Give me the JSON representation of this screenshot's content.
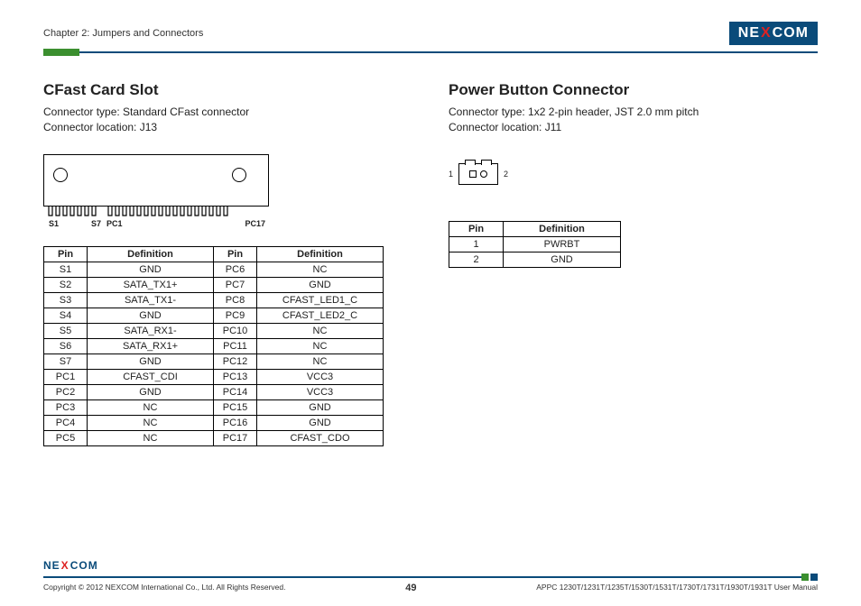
{
  "header": {
    "chapter": "Chapter 2: Jumpers and Connectors"
  },
  "left": {
    "title": "CFast Card Slot",
    "connector_type": "Connector type: Standard CFast connector",
    "connector_location": "Connector location: J13",
    "diagram_labels": {
      "s1": "S1",
      "s7": "S7",
      "pc1": "PC1",
      "pc17": "PC17"
    },
    "table": {
      "headers": {
        "pin": "Pin",
        "def": "Definition"
      },
      "rows": [
        {
          "p1": "S1",
          "d1": "GND",
          "p2": "PC6",
          "d2": "NC"
        },
        {
          "p1": "S2",
          "d1": "SATA_TX1+",
          "p2": "PC7",
          "d2": "GND"
        },
        {
          "p1": "S3",
          "d1": "SATA_TX1-",
          "p2": "PC8",
          "d2": "CFAST_LED1_C"
        },
        {
          "p1": "S4",
          "d1": "GND",
          "p2": "PC9",
          "d2": "CFAST_LED2_C"
        },
        {
          "p1": "S5",
          "d1": "SATA_RX1-",
          "p2": "PC10",
          "d2": "NC"
        },
        {
          "p1": "S6",
          "d1": "SATA_RX1+",
          "p2": "PC11",
          "d2": "NC"
        },
        {
          "p1": "S7",
          "d1": "GND",
          "p2": "PC12",
          "d2": "NC"
        },
        {
          "p1": "PC1",
          "d1": "CFAST_CDI",
          "p2": "PC13",
          "d2": "VCC3"
        },
        {
          "p1": "PC2",
          "d1": "GND",
          "p2": "PC14",
          "d2": "VCC3"
        },
        {
          "p1": "PC3",
          "d1": "NC",
          "p2": "PC15",
          "d2": "GND"
        },
        {
          "p1": "PC4",
          "d1": "NC",
          "p2": "PC16",
          "d2": "GND"
        },
        {
          "p1": "PC5",
          "d1": "NC",
          "p2": "PC17",
          "d2": "CFAST_CDO"
        }
      ]
    }
  },
  "right": {
    "title": "Power Button Connector",
    "connector_type": "Connector type: 1x2 2-pin header, JST 2.0 mm pitch",
    "connector_location": "Connector location: J11",
    "diagram_labels": {
      "one": "1",
      "two": "2"
    },
    "table": {
      "headers": {
        "pin": "Pin",
        "def": "Definition"
      },
      "rows": [
        {
          "p": "1",
          "d": "PWRBT"
        },
        {
          "p": "2",
          "d": "GND"
        }
      ]
    }
  },
  "footer": {
    "copyright": "Copyright © 2012 NEXCOM International Co., Ltd. All Rights Reserved.",
    "page": "49",
    "manual": "APPC 1230T/1231T/1235T/1530T/1531T/1730T/1731T/1930T/1931T User Manual"
  }
}
